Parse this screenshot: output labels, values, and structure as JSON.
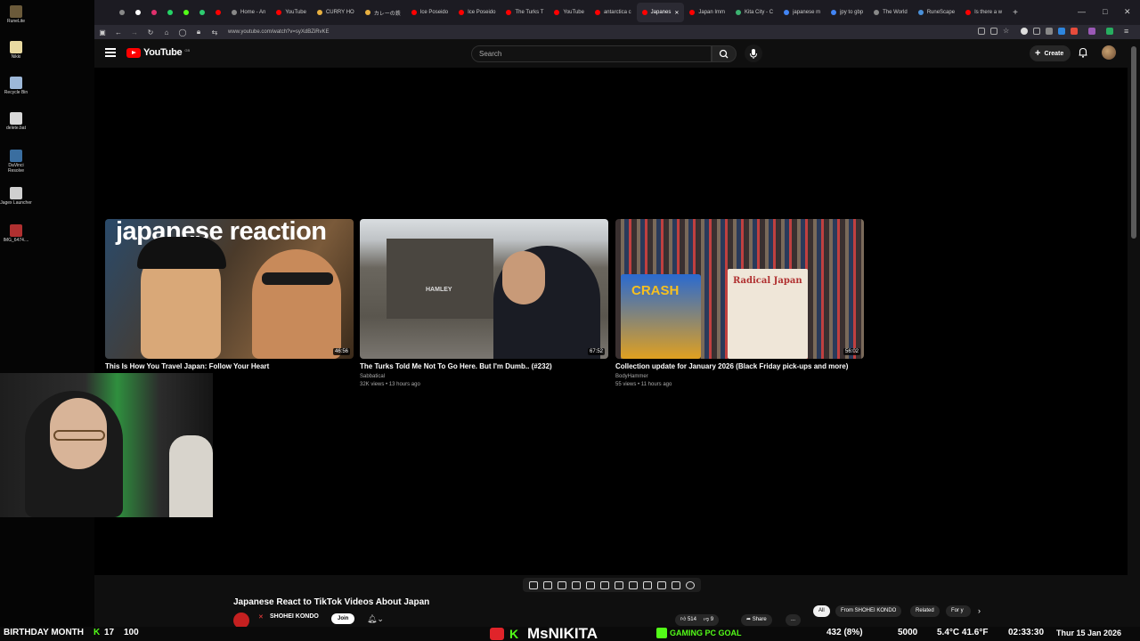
{
  "desktop": {
    "items": [
      {
        "label": "RuneLite",
        "color": "#6b5a3a"
      },
      {
        "label": "Nikki",
        "color": "#e8d9a0"
      },
      {
        "label": "Recycle Bin",
        "color": "#9db8d8"
      },
      {
        "label": "delete.bat",
        "color": "#d8d8d8"
      },
      {
        "label": "DaVinci Resolve",
        "color": "#3a6ea0"
      },
      {
        "label": "Jagex Launcher",
        "color": "#cfcfcf"
      },
      {
        "label": "IMG_6474....",
        "color": "#b03030"
      }
    ]
  },
  "tabs": [
    {
      "label": "",
      "color": "#888"
    },
    {
      "label": "",
      "color": "#fff"
    },
    {
      "label": "",
      "color": "#e1306c"
    },
    {
      "label": "",
      "color": "#25d366"
    },
    {
      "label": "",
      "color": "#53fc18"
    },
    {
      "label": "",
      "color": "#2ecc71"
    },
    {
      "label": "",
      "color": "#ff0000"
    },
    {
      "label": "Home - An",
      "color": "#888"
    },
    {
      "label": "YouTube",
      "color": "#ff0000"
    },
    {
      "label": "CURRY HO",
      "color": "#e8b040"
    },
    {
      "label": "カレーの鉄",
      "color": "#e8b040"
    },
    {
      "label": "Ice Poseido",
      "color": "#ff0000"
    },
    {
      "label": "Ice Poseido",
      "color": "#ff0000"
    },
    {
      "label": "The Turks T",
      "color": "#ff0000"
    },
    {
      "label": "YouTube",
      "color": "#ff0000"
    },
    {
      "label": "antarctica c",
      "color": "#ff0000"
    },
    {
      "label": "Japanes",
      "color": "#ff0000",
      "active": true
    },
    {
      "label": "Japan Imm",
      "color": "#ff0000"
    },
    {
      "label": "Kita City - C",
      "color": "#3cb371"
    },
    {
      "label": "japanese m",
      "color": "#4285f4"
    },
    {
      "label": "jpy to gbp",
      "color": "#4285f4"
    },
    {
      "label": "The World",
      "color": "#888"
    },
    {
      "label": "RuneScape",
      "color": "#4a90d9"
    },
    {
      "label": "Is there a w",
      "color": "#ff0000"
    }
  ],
  "navbar": {
    "url": "www.youtube.com/watch?v=syXdBZiRvKE"
  },
  "youtube": {
    "logo_text": "YouTube",
    "logo_country": "GB",
    "search_placeholder": "Search",
    "create_label": "Create"
  },
  "end_screen": [
    {
      "title": "This Is How You Travel Japan: Follow Your Heart",
      "channel": "",
      "meta": "",
      "duration": "46:56",
      "thumb_text": "japanese reaction"
    },
    {
      "title": "The Turks Told Me Not To Go Here. But I'm Dumb.. (#232)",
      "channel": "Sabbatical",
      "meta": "32K views • 13 hours ago",
      "duration": "67:52",
      "thumb_text": "HAMLEY"
    },
    {
      "title": "Collection update for January 2026 (Black Friday pick-ups and more)",
      "channel": "BodyHammer",
      "meta": "55 views • 11 hours ago",
      "duration": "56:02",
      "thumb_text": "CRASH",
      "thumb_text2": "Radical Japan"
    }
  ],
  "video": {
    "title": "Japanese React to TikTok Videos About Japan",
    "channel": "SHOHEI KONDO",
    "join_label": "Join",
    "likes": "514",
    "dislikes": "9",
    "share_label": "Share",
    "more_label": "..."
  },
  "filter_chips": [
    {
      "label": "All",
      "active": true
    },
    {
      "label": "From SHOHEI KONDO",
      "active": false
    },
    {
      "label": "Related",
      "active": false
    },
    {
      "label": "For y",
      "active": false
    }
  ],
  "stream_bar": {
    "birthday": "BIRTHDAY MONTH",
    "k_count": "17",
    "battery": "100",
    "streamer": "MsNIKITA",
    "goal_label": "GAMING PC GOAL",
    "goal_progress": "432 (8%)",
    "goal_target": "5000",
    "weather": "5.4°C 41.6°F",
    "time": "02:33:30",
    "date": "Thur 15 Jan 2026"
  },
  "colors": {
    "youtube_red": "#ff0000",
    "kick_green": "#53fc18",
    "background": "#0f0f0f"
  }
}
